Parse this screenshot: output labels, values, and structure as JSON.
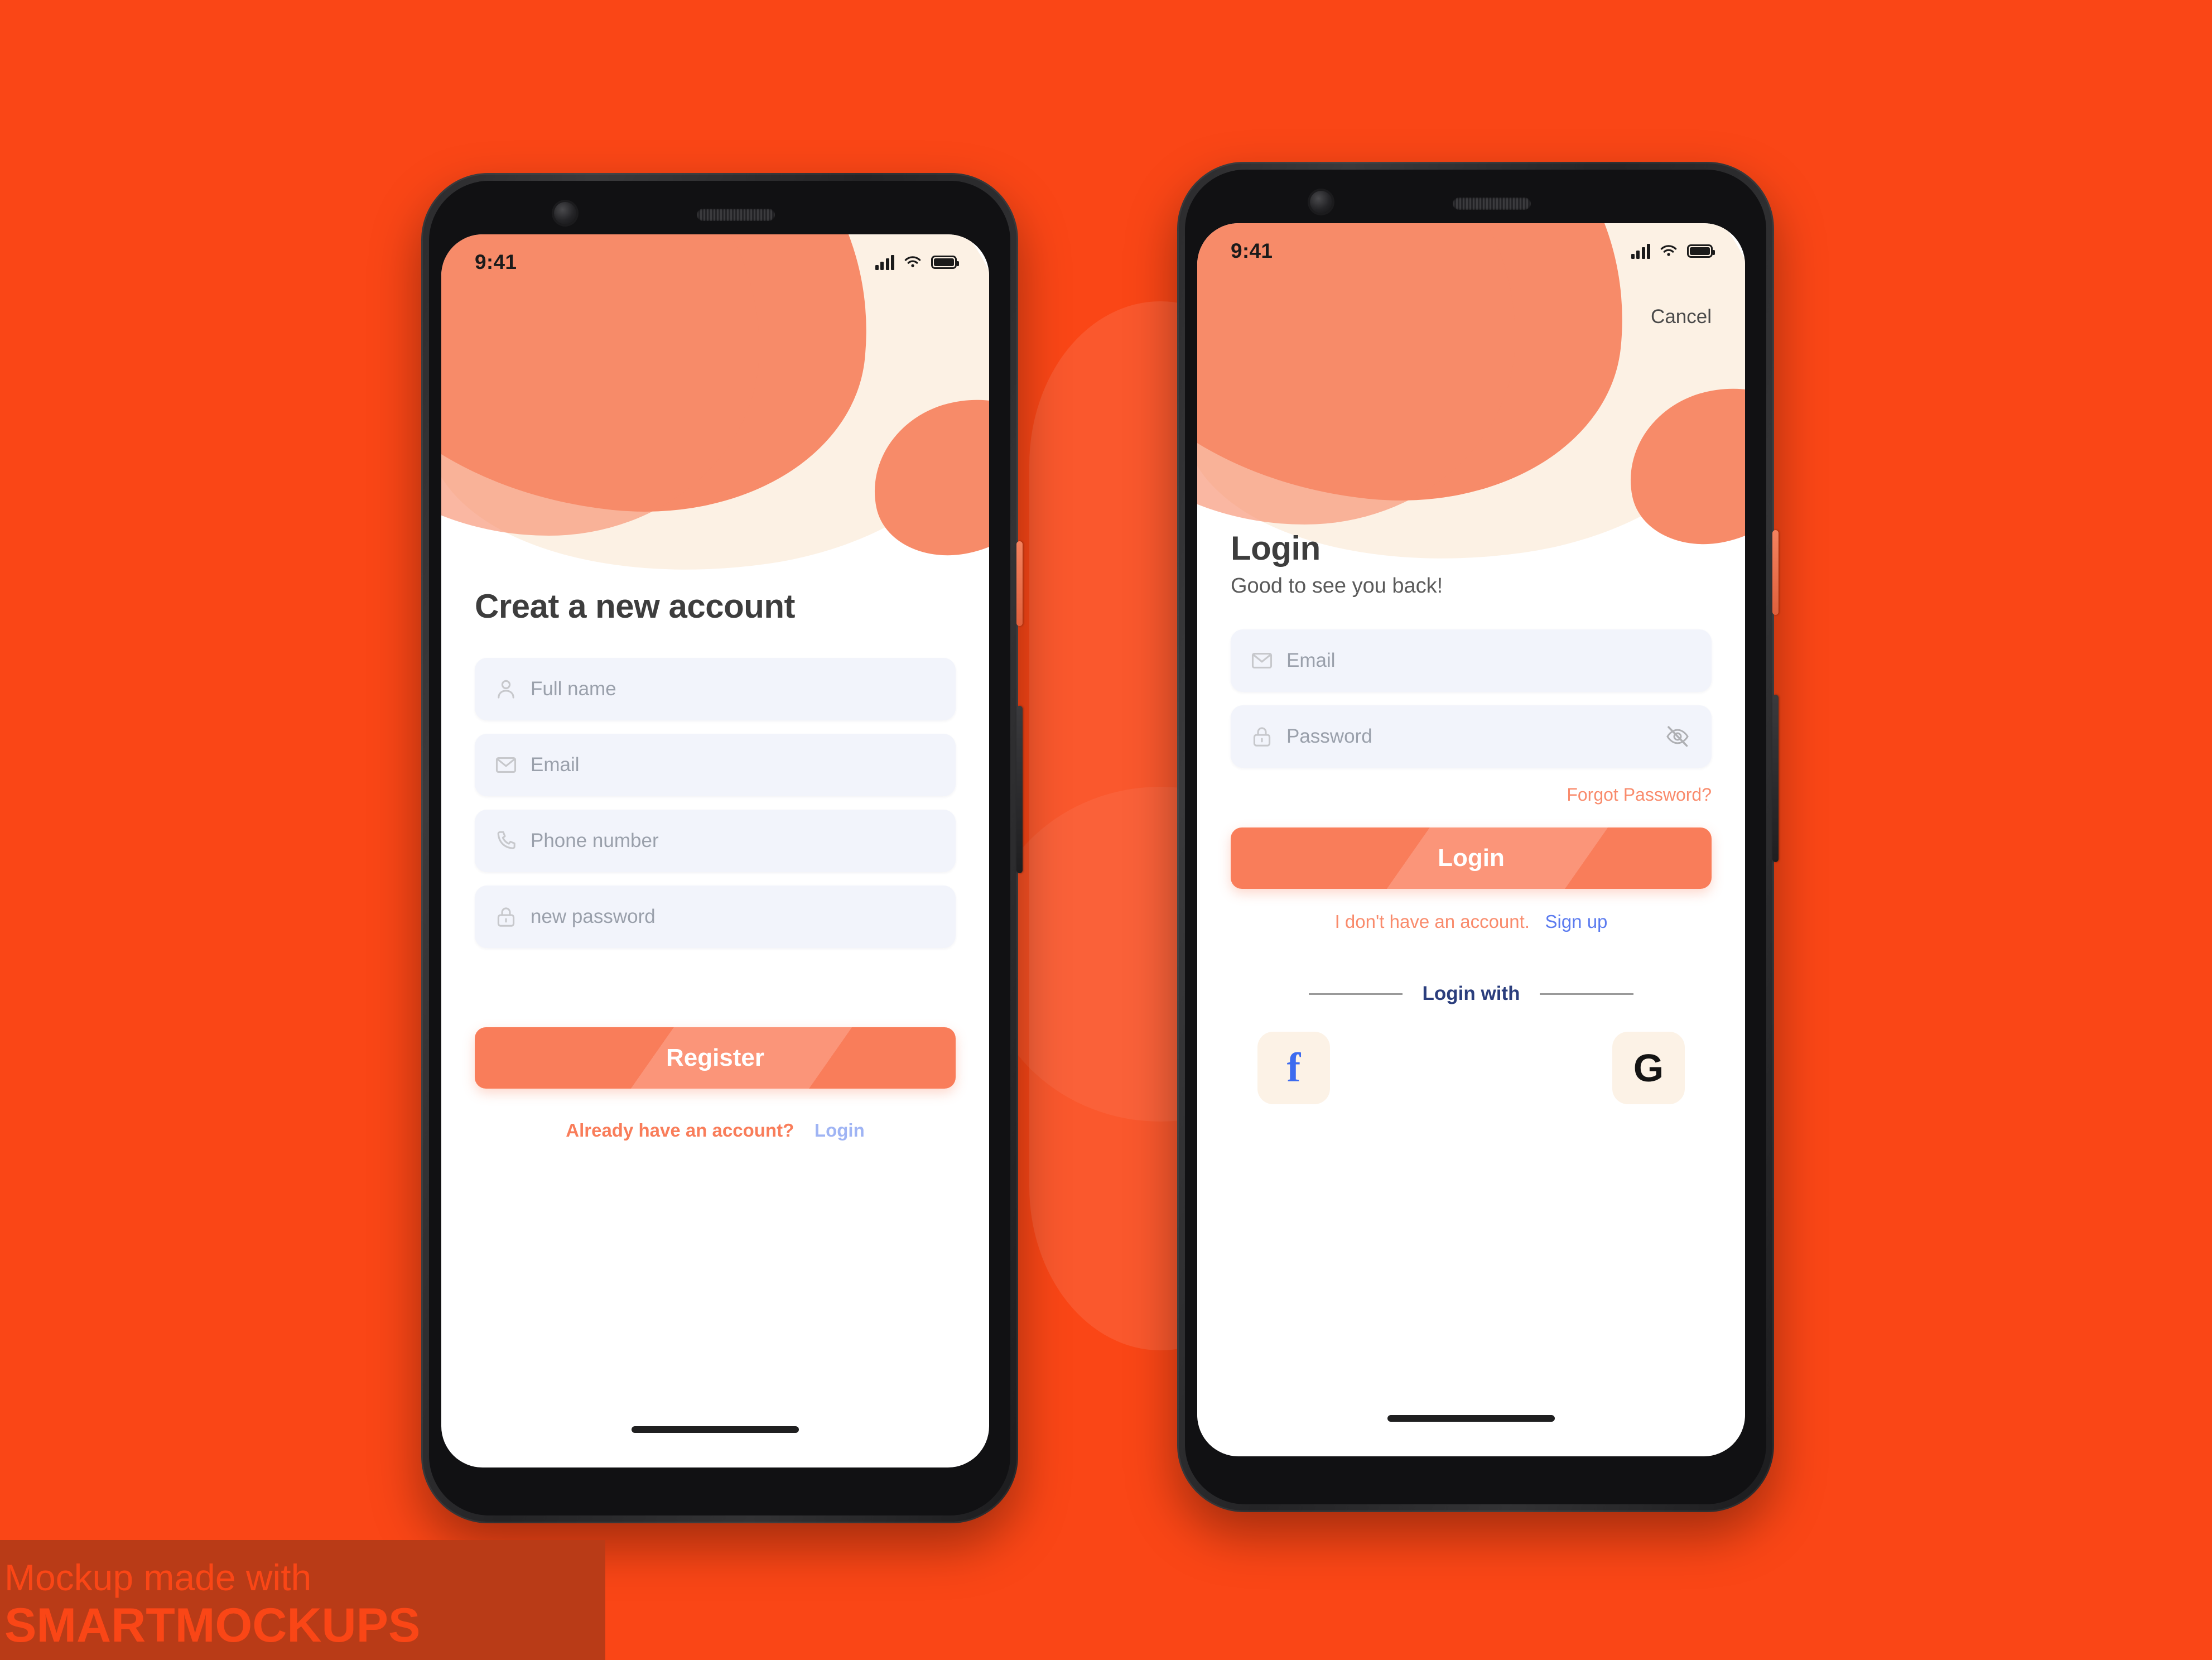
{
  "background": {
    "color": "#FA4616"
  },
  "watermark": {
    "line1": "Mockup made with",
    "line2": "SMARTMOCKUPS"
  },
  "phones": {
    "register": {
      "status_bar": {
        "time": "9:41",
        "signal_icon": "signal-bars-icon",
        "wifi_icon": "wifi-icon",
        "battery_icon": "battery-icon"
      },
      "title": "Creat a new account",
      "fields": [
        {
          "icon": "person-icon",
          "placeholder": "Full name"
        },
        {
          "icon": "envelope-icon",
          "placeholder": "Email"
        },
        {
          "icon": "phone-icon",
          "placeholder": "Phone number"
        },
        {
          "icon": "lock-icon",
          "placeholder": "new password"
        }
      ],
      "submit_label": "Register",
      "footer_text": "Already have an account?",
      "footer_link": "Login"
    },
    "login": {
      "status_bar": {
        "time": "9:41",
        "signal_icon": "signal-bars-icon",
        "wifi_icon": "wifi-icon",
        "battery_icon": "battery-icon"
      },
      "cancel_label": "Cancel",
      "title": "Login",
      "subtitle": "Good to see you back!",
      "fields": [
        {
          "icon": "envelope-icon",
          "placeholder": "Email"
        },
        {
          "icon": "lock-icon",
          "placeholder": "Password",
          "trailing_icon": "eye-off-icon"
        }
      ],
      "forgot_label": "Forgot Password?",
      "submit_label": "Login",
      "footer_text": "I don't have an account.",
      "footer_link": "Sign up",
      "divider_label": "Login with",
      "social": [
        {
          "name": "facebook",
          "glyph": "f"
        },
        {
          "name": "google",
          "glyph": "G"
        }
      ]
    }
  },
  "colors": {
    "brand_orange": "#FA4616",
    "coral": "#F78B69",
    "cta": "#F97D5A",
    "cream": "#FCF1E4",
    "field_bg": "#F2F4FB",
    "link_blue": "#5B7BEF",
    "divider_navy": "#2B3E7D"
  }
}
